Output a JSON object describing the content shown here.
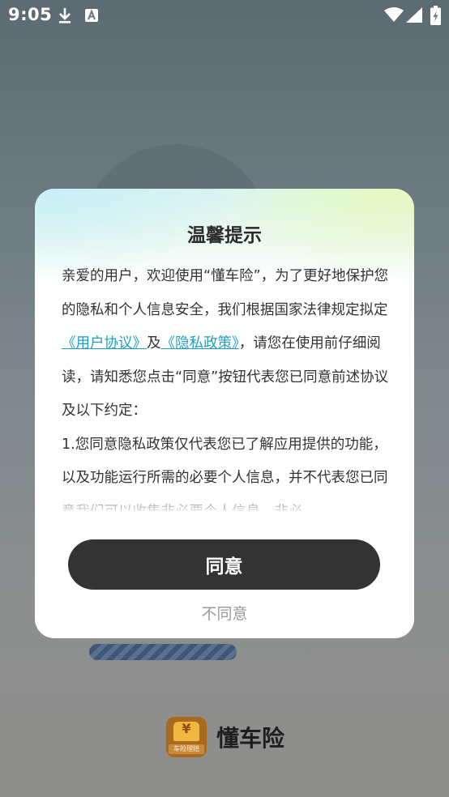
{
  "status_bar": {
    "time": "9:05",
    "icons_left": [
      "download-icon",
      "keyboard-a-icon"
    ],
    "icons_right": [
      "wifi-icon",
      "cellular-signal-icon",
      "battery-charging-icon"
    ]
  },
  "background": {
    "brand_name": "懂车险",
    "logo_sub_text": "车险理赔",
    "logo_symbol": "¥",
    "progress_fraction": 1.0
  },
  "dialog": {
    "title": "温馨提示",
    "intro_before_links": "亲爱的用户，欢迎使用“懂车险”，为了更好地保护您的隐私和个人信息安全，我们根据国家法律规定拟定",
    "link_user_agreement": "《用户协议》",
    "conjunction": "及",
    "link_privacy_policy": "《隐私政策》",
    "intro_after_links": "，请您在使用前仔细阅读，请知悉您点击“同意”按钮代表您已同意前述协议及以下约定：",
    "clause_1": "1.您同意隐私政策仅代表您已了解应用提供的功能，以及功能运行所需的必要个人信息，并不代表您已同意我们可以收集非必要个人信息，非必",
    "agree_label": "同意",
    "disagree_label": "不同意"
  },
  "colors": {
    "link": "#1f9fbf",
    "agree_button_bg": "#333333",
    "disagree_text": "#9a9a9a"
  }
}
